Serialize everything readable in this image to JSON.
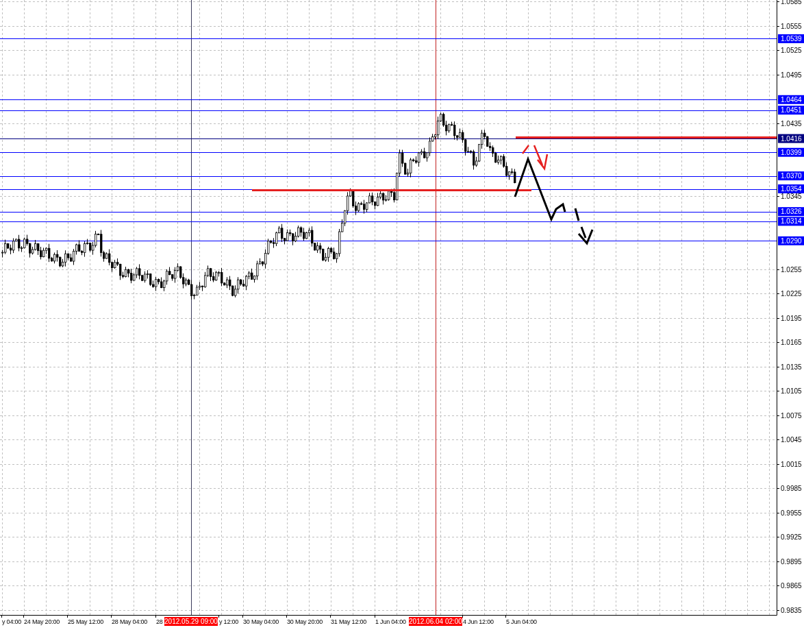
{
  "chart": {
    "price_axis": {
      "ticks": [
        "1.0585",
        "1.0555",
        "1.0525",
        "1.0495",
        "1.0435",
        "1.0345",
        "1.0255",
        "1.0225",
        "1.0195",
        "1.0165",
        "1.0135",
        "1.0105",
        "1.0075",
        "1.0045",
        "1.0015",
        "0.9985",
        "0.9955",
        "0.9925",
        "0.9895",
        "0.9865",
        "0.9835"
      ]
    },
    "levels": [
      {
        "price": "1.0539",
        "color": "#0000ff"
      },
      {
        "price": "1.0464",
        "color": "#0000ff"
      },
      {
        "price": "1.0451",
        "color": "#0000ff"
      },
      {
        "price": "1.0416",
        "color": "#000080"
      },
      {
        "price": "1.0399",
        "color": "#0000ff"
      },
      {
        "price": "1.0370",
        "color": "#0000ff"
      },
      {
        "price": "1.0354",
        "color": "#0000ff"
      },
      {
        "price": "1.0326",
        "color": "#0000ff"
      },
      {
        "price": "1.0314",
        "color": "#0000ff"
      },
      {
        "price": "1.0290",
        "color": "#0000ff"
      }
    ],
    "time_axis": {
      "labels": [
        {
          "text": "y 04:00",
          "kind": "tick"
        },
        {
          "text": "24 May 20:00",
          "kind": "tick"
        },
        {
          "text": "25 May 12:00",
          "kind": "tick"
        },
        {
          "text": "28 May 04:00",
          "kind": "tick"
        },
        {
          "text": "28",
          "kind": "tick"
        },
        {
          "text": "2012.05.29 09:00",
          "kind": "crosshair"
        },
        {
          "text": "y 12:00",
          "kind": "tick"
        },
        {
          "text": "30 May 04:00",
          "kind": "tick"
        },
        {
          "text": "30 May 20:00",
          "kind": "tick"
        },
        {
          "text": "31 May 12:00",
          "kind": "tick"
        },
        {
          "text": "1 Jun 04:00",
          "kind": "tick"
        },
        {
          "text": "2012.06.04 02:00",
          "kind": "crosshair"
        },
        {
          "text": "4 Jun 12:00",
          "kind": "tick"
        },
        {
          "text": "5 Jun 04:00",
          "kind": "tick"
        }
      ]
    }
  }
}
